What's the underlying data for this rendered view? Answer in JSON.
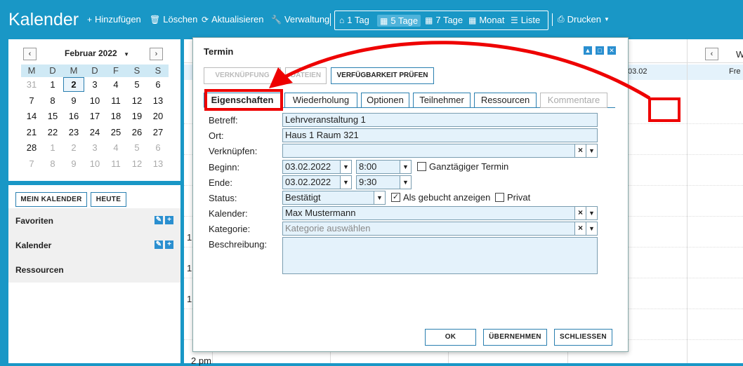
{
  "app": {
    "title": "Kalender"
  },
  "toolbar": {
    "add": "Hinzufügen",
    "delete": "Löschen",
    "refresh": "Aktualisieren",
    "admin": "Verwaltung",
    "view_1day": "1 Tag",
    "view_5day": "5 Tage",
    "view_7day": "7 Tage",
    "view_month": "Monat",
    "view_list": "Liste",
    "print": "Drucken"
  },
  "minical": {
    "month": "Februar 2022",
    "prev": "‹",
    "next": "›",
    "weekdays": [
      "M",
      "D",
      "M",
      "D",
      "F",
      "S",
      "S"
    ],
    "weeks": [
      [
        "31",
        "1",
        "2",
        "3",
        "4",
        "5",
        "6"
      ],
      [
        "7",
        "8",
        "9",
        "10",
        "11",
        "12",
        "13"
      ],
      [
        "14",
        "15",
        "16",
        "17",
        "18",
        "19",
        "20"
      ],
      [
        "21",
        "22",
        "23",
        "24",
        "25",
        "26",
        "27"
      ],
      [
        "28",
        "1",
        "2",
        "3",
        "4",
        "5",
        "6"
      ],
      [
        "7",
        "8",
        "9",
        "10",
        "11",
        "12",
        "13"
      ]
    ]
  },
  "sidebar": {
    "my_calendar": "MEIN KALENDER",
    "today": "HEUTE",
    "favorites": "Favoriten",
    "calendars": "Kalender",
    "resources": "Ressourcen"
  },
  "background": {
    "date_1": "03.02",
    "date_2": "Fre",
    "head_partial": "W",
    "nav_prev": "‹",
    "times": [
      "1",
      "1",
      "1",
      "2 pm"
    ]
  },
  "dialog": {
    "title": "Termin",
    "btn_link": "VERKNÜPFUNG",
    "btn_files": "DATEIEN",
    "btn_check": "VERFÜGBARKEIT PRÜFEN",
    "tabs": [
      "Eigenschaften",
      "Wiederholung",
      "Optionen",
      "Teilnehmer",
      "Ressourcen",
      "Kommentare"
    ],
    "labels": {
      "subject": "Betreff:",
      "location": "Ort:",
      "link": "Verknüpfen:",
      "start": "Beginn:",
      "end": "Ende:",
      "status": "Status:",
      "calendar": "Kalender:",
      "category": "Kategorie:",
      "description": "Beschreibung:"
    },
    "values": {
      "subject": "Lehrveranstaltung 1",
      "location": "Haus 1 Raum 321",
      "link": "",
      "start_date": "03.02.2022",
      "start_time": "8:00",
      "end_date": "03.02.2022",
      "end_time": "9:30",
      "status": "Bestätigt",
      "calendar": "Max Mustermann",
      "category_placeholder": "Kategorie auswählen",
      "description": ""
    },
    "checks": {
      "allday": "Ganztägiger Termin",
      "booked": "Als gebucht anzeigen",
      "private": "Privat"
    },
    "footer": {
      "ok": "OK",
      "apply": "ÜBERNEHMEN",
      "close": "SCHLIESSEN"
    }
  },
  "colors": {
    "accent": "#1997c6",
    "annotation": "#e00000"
  }
}
